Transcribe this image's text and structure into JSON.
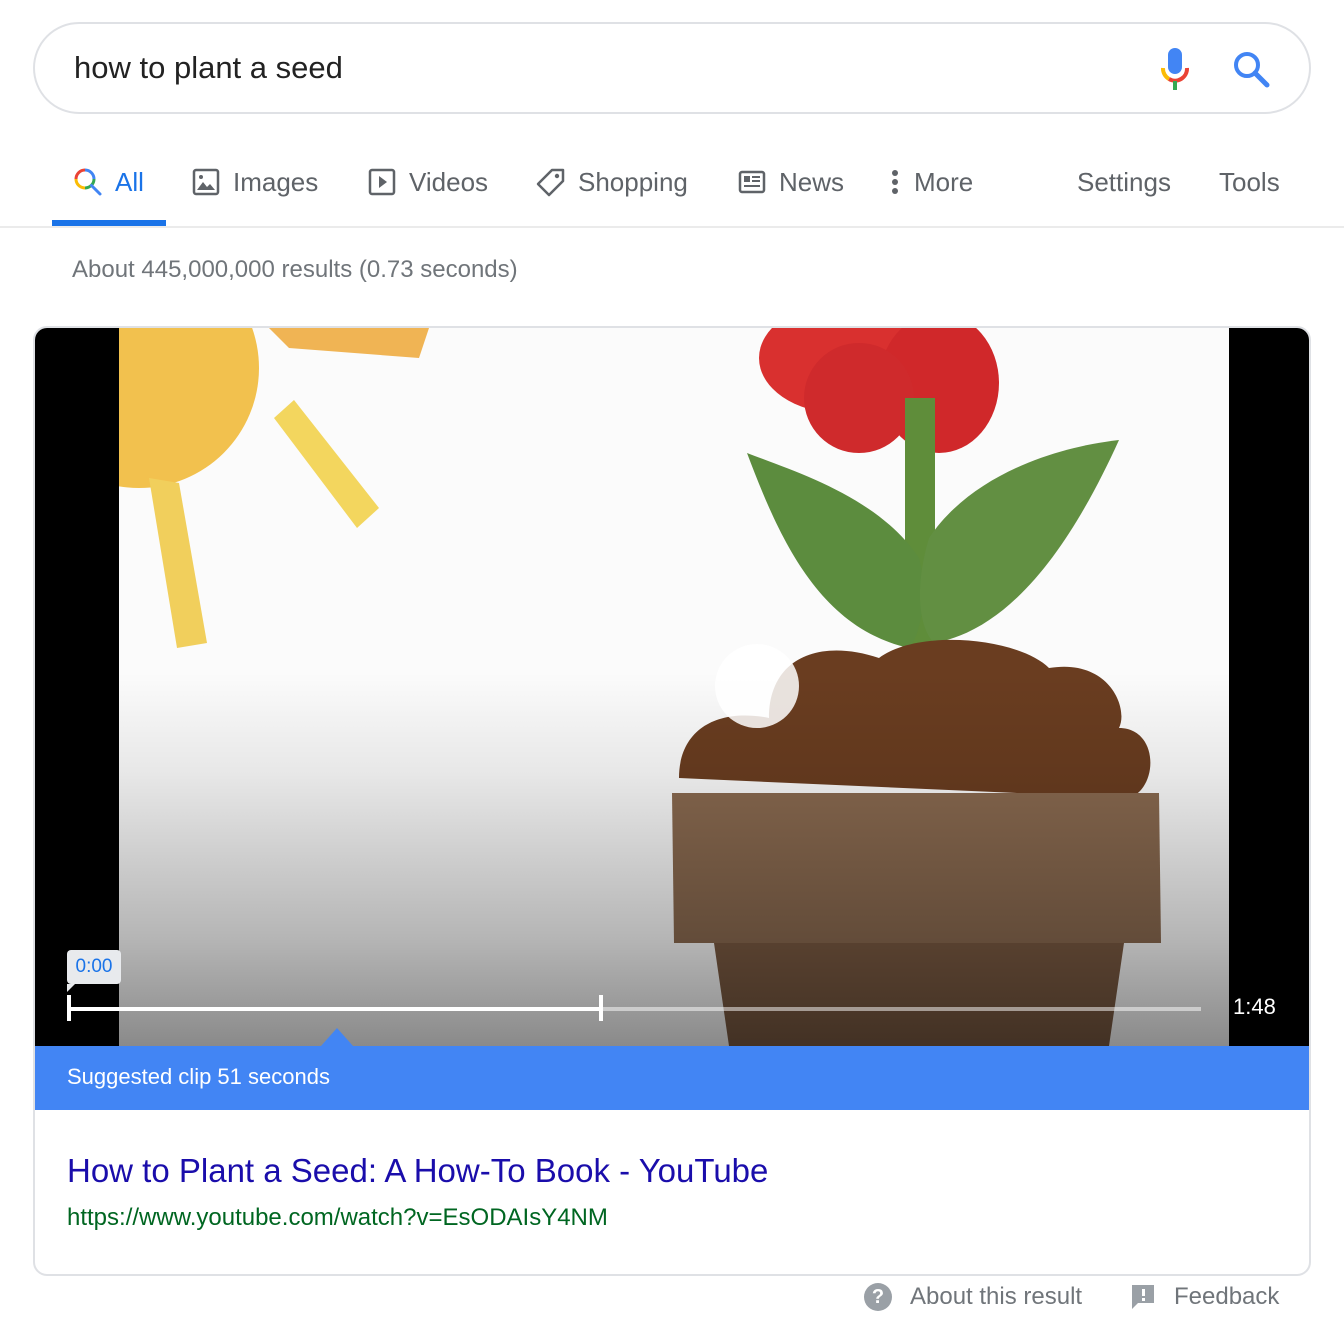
{
  "search": {
    "query": "how to plant a seed",
    "mic_icon": "microphone-icon",
    "search_icon": "search-icon"
  },
  "tabs": [
    {
      "label": "All",
      "icon": "search-icon",
      "active": true
    },
    {
      "label": "Images",
      "icon": "image-icon",
      "active": false
    },
    {
      "label": "Videos",
      "icon": "play-icon",
      "active": false
    },
    {
      "label": "Shopping",
      "icon": "tag-icon",
      "active": false
    },
    {
      "label": "News",
      "icon": "newspaper-icon",
      "active": false
    },
    {
      "label": "More",
      "icon": "more-vertical-icon",
      "active": false
    }
  ],
  "tools": {
    "settings_label": "Settings",
    "tools_label": "Tools"
  },
  "result_stats": "About 445,000,000 results (0.73 seconds)",
  "video": {
    "clip_start": "0:00",
    "duration": "1:48",
    "clip_progress_fraction": 0.47,
    "suggested_clip": "Suggested clip 51 seconds"
  },
  "result": {
    "title": "How to Plant a Seed: A How-To Book - YouTube",
    "url": "https://www.youtube.com/watch?v=EsODAIsY4NM"
  },
  "footer": {
    "about_label": "About this result",
    "feedback_label": "Feedback"
  },
  "colors": {
    "accent": "#1a73e8",
    "clip_bar": "#4285f4",
    "link": "#1a0dab",
    "url": "#006621"
  }
}
